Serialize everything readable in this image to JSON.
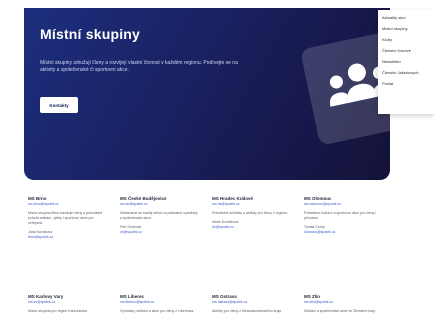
{
  "hero": {
    "title": "Místní skupiny",
    "description": "Místní skupiny sdružují členy a rozvíjejí vlastní činnost v každém regionu. Podívejte se na aktivity a společenské či sportovní akce.",
    "button_label": "Kontakty",
    "illustration_icon": "group-people-icon"
  },
  "menu": {
    "items": [
      "Aktuality akcí",
      "Místní skupiny",
      "Kluby",
      "Členství Kávové",
      "Newsletter",
      "Členství Jakešových",
      "Poslat"
    ]
  },
  "branches": [
    {
      "name": "MS Brno",
      "email": "ms.brno@spolek.cz",
      "text": "Místní skupina Brno sdružuje členy a pravidelně pořádá setkání, výlety i sportovní akce pro veřejnost.",
      "contact": "Jana Nováková",
      "phone": "brno@spolek.cz"
    },
    {
      "name": "MS České Budějovice",
      "email": "ms.cb@spolek.cz",
      "text": "Setkáváme se každý měsíc a pořádáme vycházky a společenské akce.",
      "contact": "Petr Svoboda",
      "phone": "cb@spolek.cz"
    },
    {
      "name": "MS Hradec Králové",
      "email": "ms.hk@spolek.cz",
      "text": "Pravidelné schůzky a aktivity pro členy v regionu.",
      "contact": "Marie Dvořáková",
      "phone": "hk@spolek.cz"
    },
    {
      "name": "MS Olomouc",
      "email": "ms.olomouc@spolek.cz",
      "text": "Pořádáme kulturní a sportovní akce pro členy i příznivce.",
      "contact": "Tomáš Černý",
      "phone": "olomouc@spolek.cz"
    },
    {
      "name": "MS Karlovy Vary",
      "email": "ms.kv@spolek.cz",
      "text": "Místní skupina pro region Karlovarska.",
      "contact": "",
      "phone": ""
    },
    {
      "name": "MS Liberec",
      "email": "ms.liberec@spolek.cz",
      "text": "Vycházky, setkání a akce pro členy z Liberecka.",
      "contact": "",
      "phone": ""
    },
    {
      "name": "MS Ostrava",
      "email": "ms.ostrava@spolek.cz",
      "text": "Aktivity pro členy z Moravskoslezského kraje.",
      "contact": "",
      "phone": ""
    },
    {
      "name": "MS Zlín",
      "email": "ms.zlin@spolek.cz",
      "text": "Setkání a společenské akce ve Zlínském kraji.",
      "contact": "",
      "phone": ""
    }
  ]
}
